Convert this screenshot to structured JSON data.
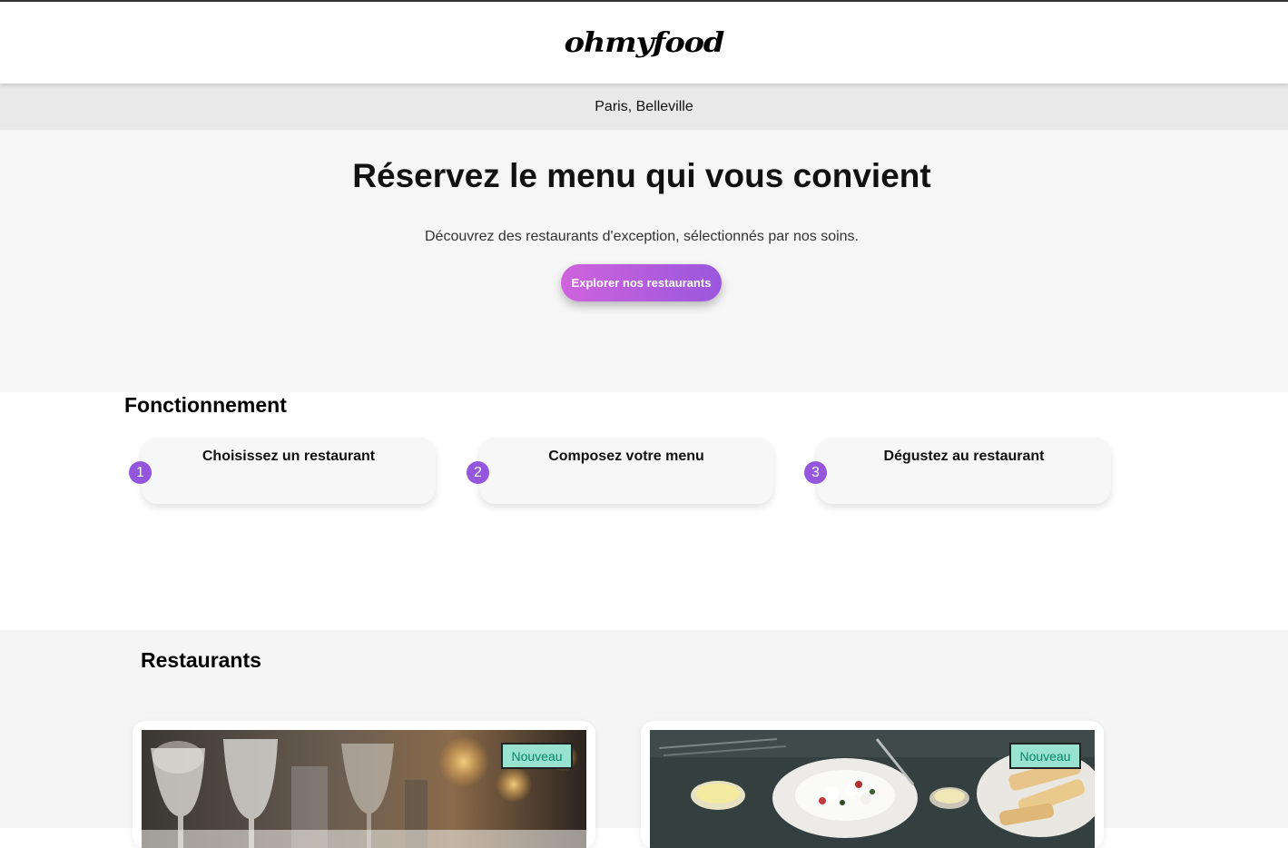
{
  "header": {
    "logo": "ohmyfood"
  },
  "location": "Paris, Belleville",
  "hero": {
    "title": "Réservez le menu qui vous convient",
    "subtitle": "Découvrez des restaurants d'exception, sélectionnés par nos soins.",
    "cta": "Explorer nos restaurants"
  },
  "how": {
    "title": "Fonctionnement",
    "steps": [
      {
        "num": "1",
        "label": "Choisissez un restaurant"
      },
      {
        "num": "2",
        "label": "Composez votre menu"
      },
      {
        "num": "3",
        "label": "Dégustez au restaurant"
      }
    ]
  },
  "restaurants": {
    "title": "Restaurants",
    "cards": [
      {
        "badge": "Nouveau"
      },
      {
        "badge": "Nouveau"
      }
    ]
  },
  "colors": {
    "accent_start": "#cf63dd",
    "accent_end": "#9356dc",
    "badge_bg": "#99e2d0",
    "badge_text": "#008766"
  }
}
